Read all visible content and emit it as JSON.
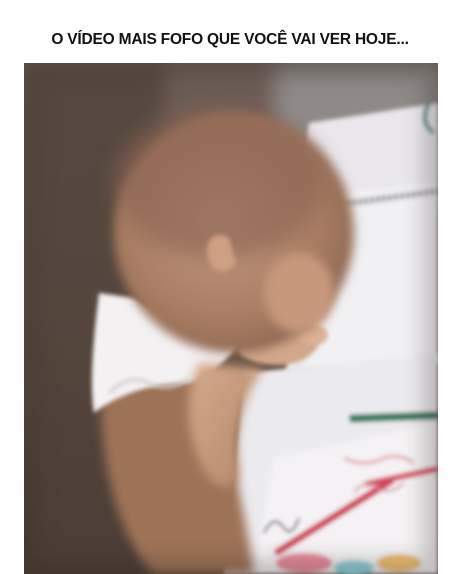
{
  "post": {
    "caption": "O VÍDEO MAIS FOFO QUE VOCÊ VAI VER HOJE...",
    "media_type": "video-still"
  }
}
